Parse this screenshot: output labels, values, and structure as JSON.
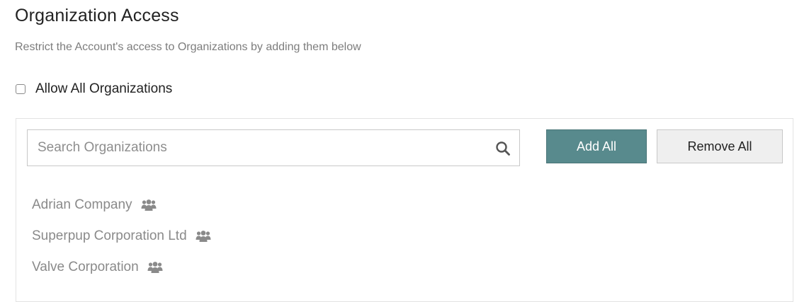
{
  "header": {
    "title": "Organization Access",
    "subtitle": "Restrict the Account's access to Organizations by adding them below"
  },
  "allow_all": {
    "label": "Allow All Organizations",
    "checked": false
  },
  "search": {
    "placeholder": "Search Organizations",
    "value": "",
    "icon": "search-icon"
  },
  "actions": {
    "add_all_label": "Add All",
    "remove_all_label": "Remove All"
  },
  "organizations": [
    {
      "name": "Adrian Company",
      "icon": "users-icon"
    },
    {
      "name": "Superpup Corporation Ltd",
      "icon": "users-icon"
    },
    {
      "name": "Valve Corporation",
      "icon": "users-icon"
    }
  ],
  "colors": {
    "primary_button": "#588a8d",
    "secondary_button": "#efefef",
    "muted_text": "#8a8a8a"
  }
}
